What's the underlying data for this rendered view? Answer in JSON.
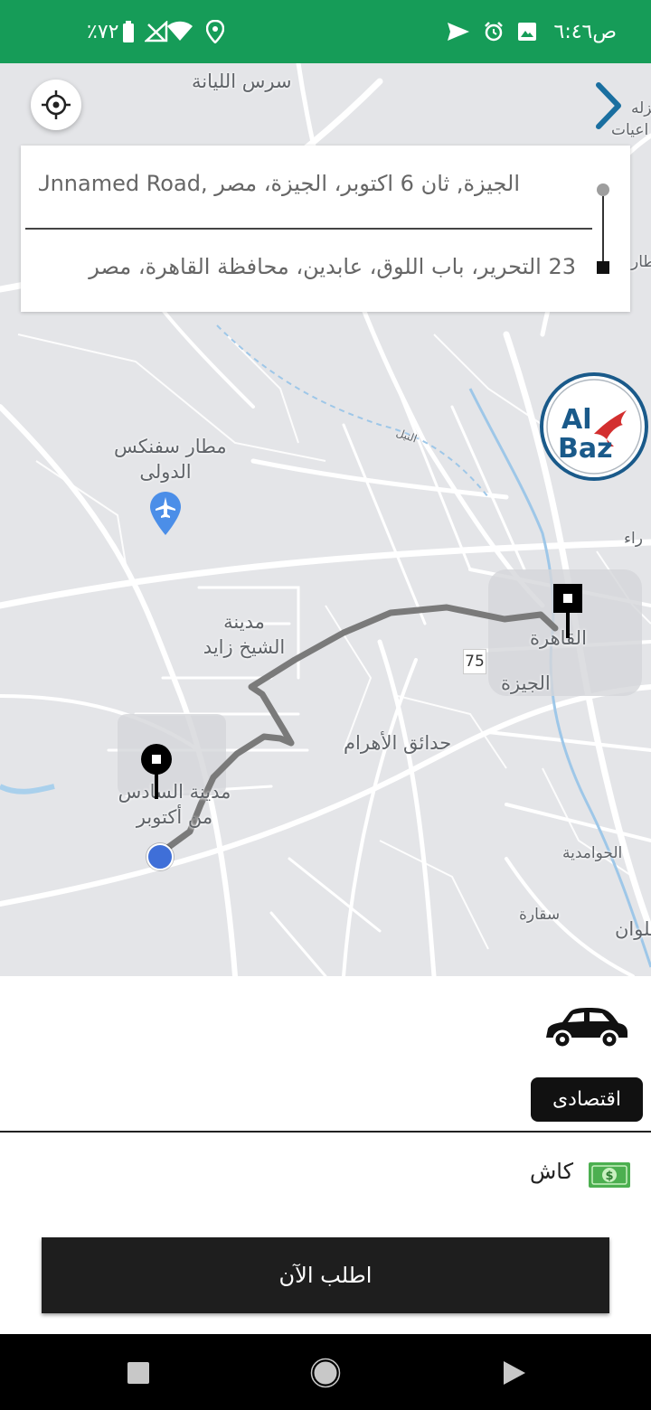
{
  "status_bar": {
    "time": "٦:٤٦",
    "period": "ص",
    "battery": "٪٧٢"
  },
  "map": {
    "labels": {
      "sers_elyana": "سرس الليانة",
      "airport_line1": "مطار سفنكس",
      "airport_line2": "الدولى",
      "sheikh_zayed_line1": "مدينة",
      "sheikh_zayed_line2": "الشيخ زايد",
      "october_line1": "مدينة السادس",
      "october_line2": "من أكتوبر",
      "hadayek_ahram": "حدائق الأهرام",
      "cairo": "القاهرة",
      "giza": "الجيزة",
      "road_75": "75",
      "hawamdeya": "الحوامدية",
      "saqqara": "سقارة",
      "helwan": "حلوان",
      "edge_top_right": "نزله",
      "edge_top_right_2": "اعيات",
      "edge_right": "طار",
      "edge_right_2": "راء",
      "nile": "النيل"
    }
  },
  "address_card": {
    "pickup": "الجيزة, ثان 6 اكتوبر، الجيزة، مصر ,Unnamed Road",
    "destination": "23 التحرير، باب اللوق، عابدين، محافظة القاهرة، مصر"
  },
  "brand": {
    "name_line1": "Al",
    "name_line2": "Baz",
    "ring_color": "#1a5a8a",
    "text_color": "#1a5a8a",
    "bird_color": "#d32f2f"
  },
  "bottom_sheet": {
    "ride_class": "اقتصادى",
    "payment_method": "كاش",
    "order_button": "اطلب الآن"
  },
  "colors": {
    "status_bar": "#169c58",
    "route": "#7a7a7a",
    "current_location": "#3f6fd8",
    "cash_icon": "#4caf50"
  },
  "icons": {
    "locate": "crosshair-icon",
    "next": "chevron-right-icon",
    "car": "car-icon",
    "cash": "cash-icon",
    "nav_recents": "square-icon",
    "nav_home": "circle-icon",
    "nav_back": "triangle-icon"
  }
}
